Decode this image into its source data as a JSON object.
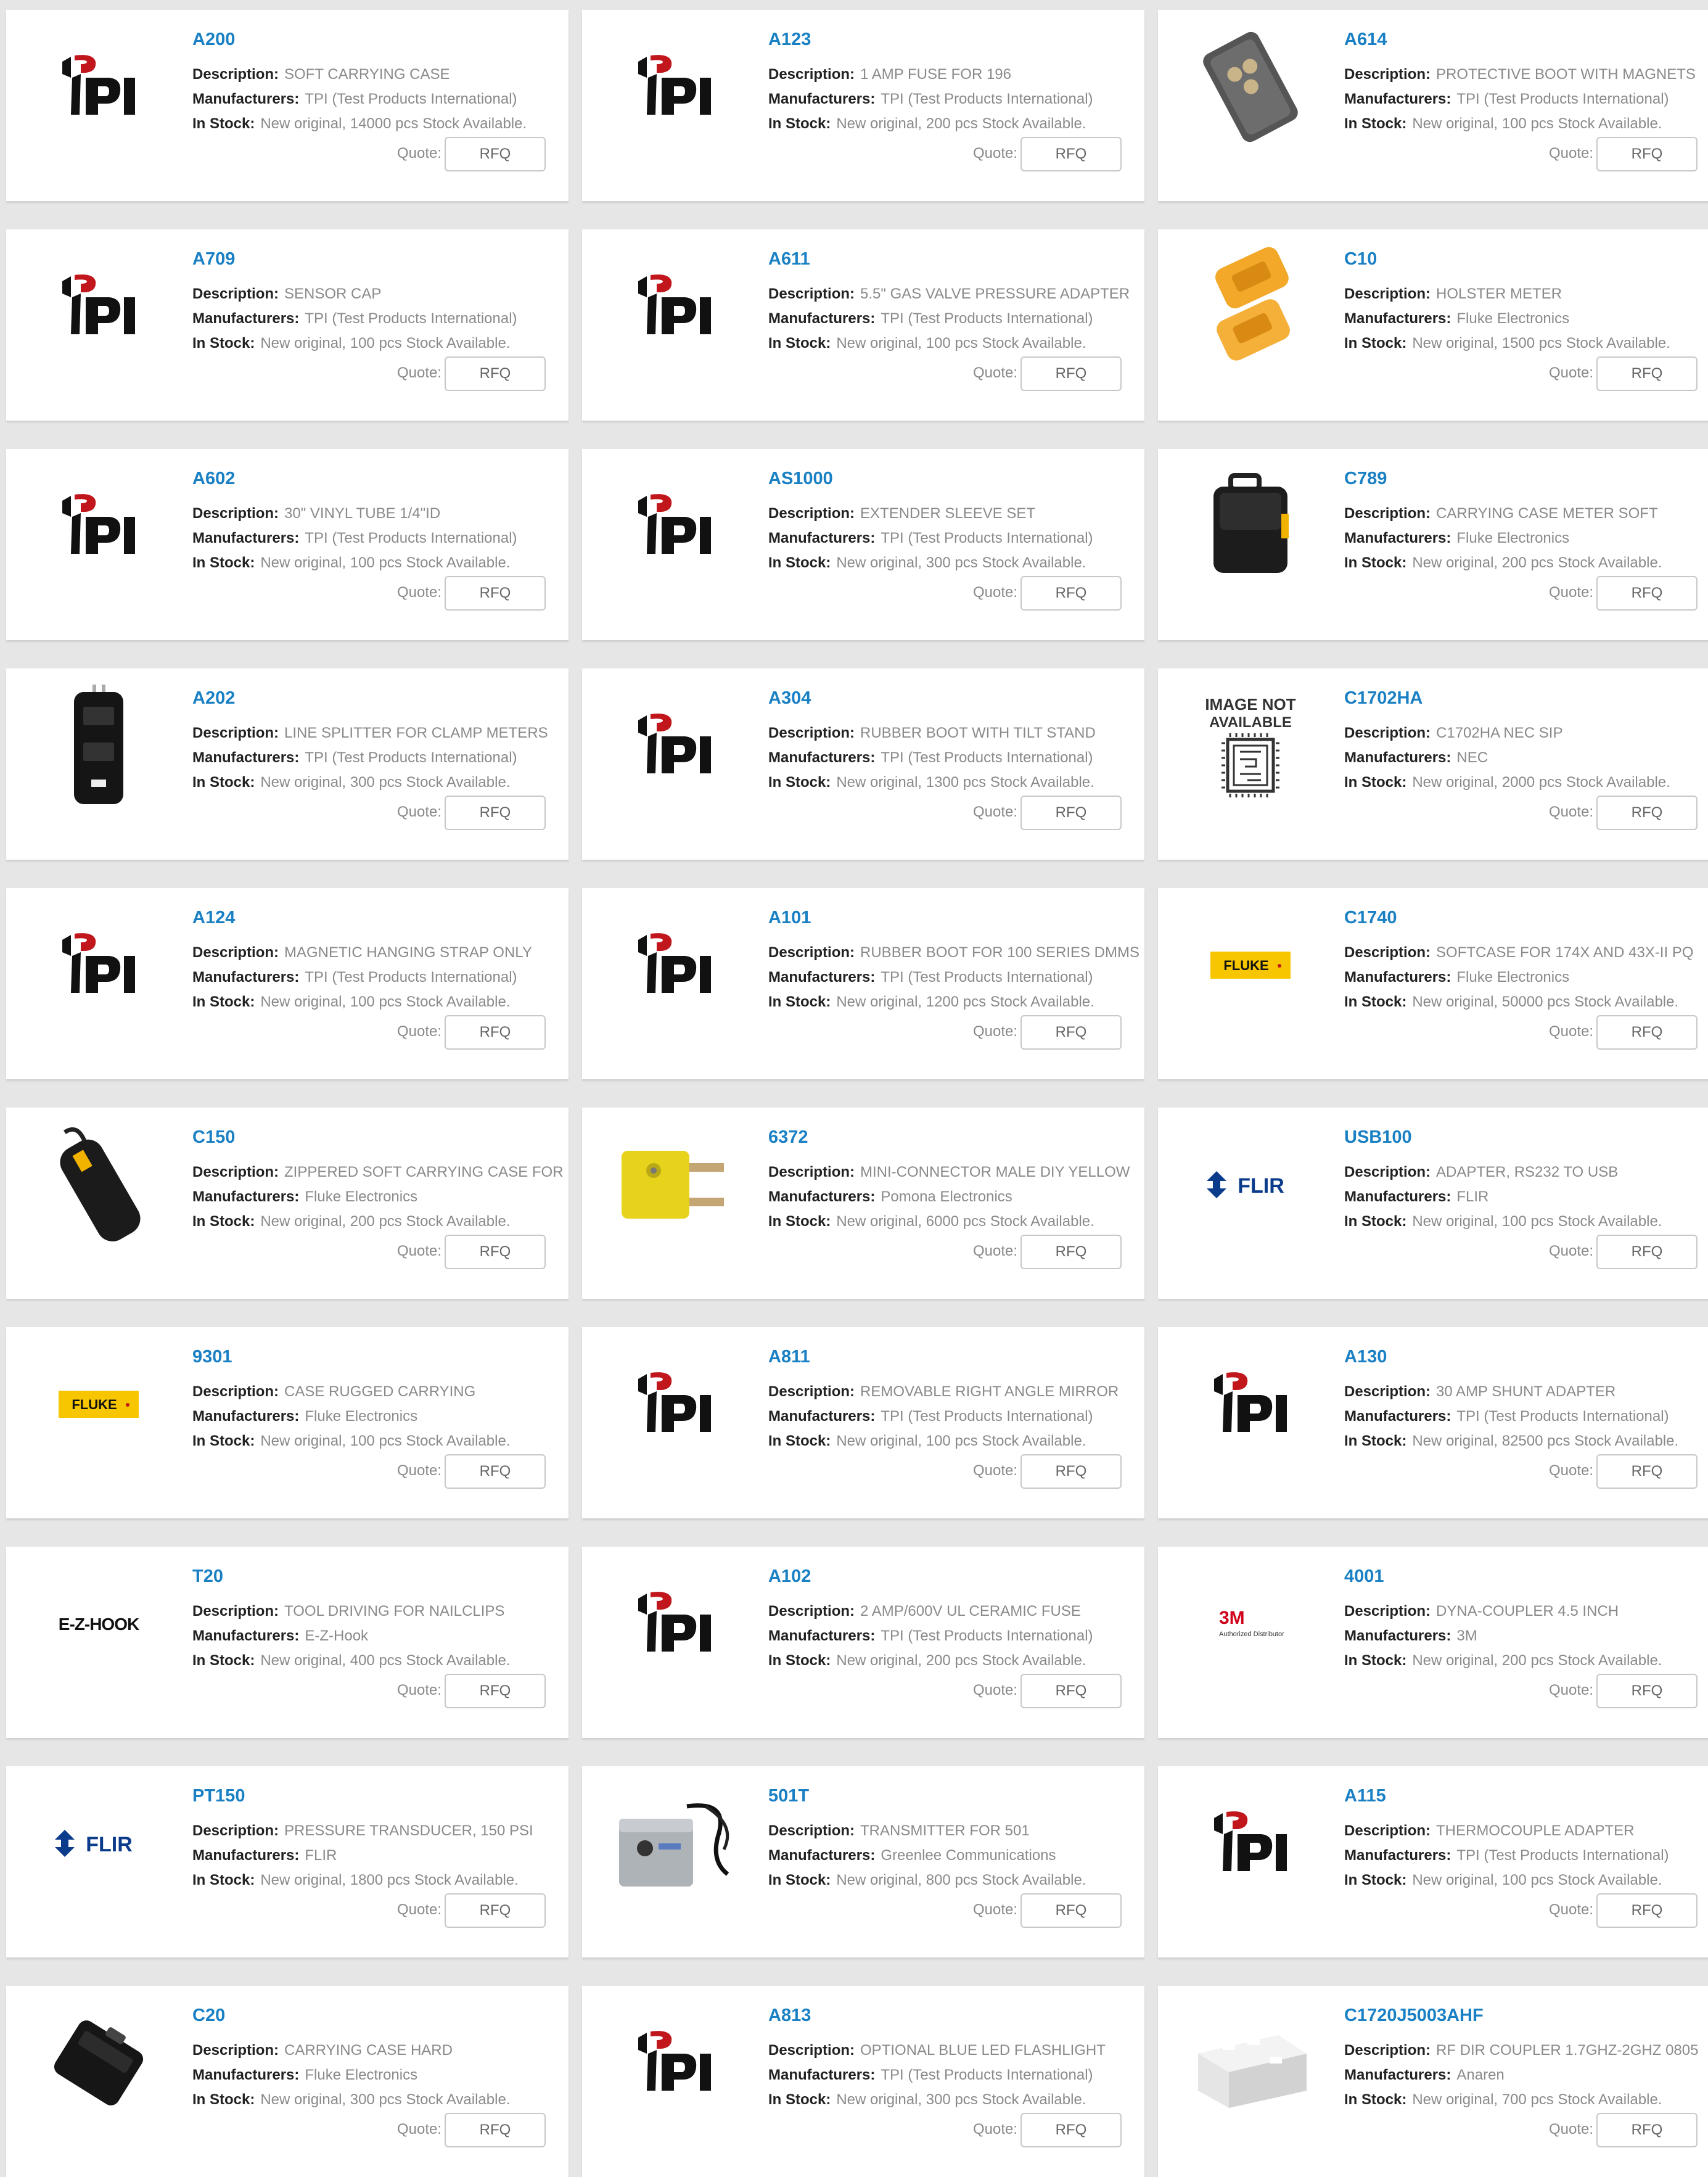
{
  "labels": {
    "description": "Description:",
    "manufacturers": "Manufacturers:",
    "in_stock": "In Stock:",
    "quote": "Quote:",
    "rfq": "RFQ"
  },
  "colors": {
    "part_number": "#1a80c4",
    "label": "#222222",
    "value": "#8a8a8a",
    "page_background": "#e6e6e6",
    "card_background": "#ffffff"
  },
  "logos": {
    "tpi": "tpi",
    "fluke": "FLUKE",
    "flir": "FLIR",
    "ezhook": "E-Z-HOOK",
    "threem": "3M",
    "threem_sub": "Authorized Distributor",
    "image_na_1": "IMAGE NOT",
    "image_na_2": "AVAILABLE"
  },
  "products": [
    {
      "part": "A200",
      "description": "SOFT CARRYING CASE",
      "manufacturer": "TPI (Test Products International)",
      "stock": "New original, 14000 pcs Stock Available.",
      "image": "tpi-logo"
    },
    {
      "part": "A123",
      "description": "1 AMP FUSE FOR 196",
      "manufacturer": "TPI (Test Products International)",
      "stock": "New original, 200 pcs Stock Available.",
      "image": "tpi-logo"
    },
    {
      "part": "A614",
      "description": "PROTECTIVE BOOT WITH MAGNETS",
      "manufacturer": "TPI (Test Products International)",
      "stock": "New original, 100 pcs Stock Available.",
      "image": "gray-boot"
    },
    {
      "part": "A709",
      "description": "SENSOR CAP",
      "manufacturer": "TPI (Test Products International)",
      "stock": "New original, 100 pcs Stock Available.",
      "image": "tpi-logo"
    },
    {
      "part": "A611",
      "description": "5.5\" GAS VALVE PRESSURE ADAPTER",
      "manufacturer": "TPI (Test Products International)",
      "stock": "New original, 100 pcs Stock Available.",
      "image": "tpi-logo"
    },
    {
      "part": "C10",
      "description": "HOLSTER METER",
      "manufacturer": "Fluke Electronics",
      "stock": "New original, 1500 pcs Stock Available.",
      "image": "yellow-holster"
    },
    {
      "part": "A602",
      "description": "30\" VINYL TUBE 1/4\"ID",
      "manufacturer": "TPI (Test Products International)",
      "stock": "New original, 100 pcs Stock Available.",
      "image": "tpi-logo"
    },
    {
      "part": "AS1000",
      "description": "EXTENDER SLEEVE SET",
      "manufacturer": "TPI (Test Products International)",
      "stock": "New original, 300 pcs Stock Available.",
      "image": "tpi-logo"
    },
    {
      "part": "C789",
      "description": "CARRYING CASE METER SOFT",
      "manufacturer": "Fluke Electronics",
      "stock": "New original, 200 pcs Stock Available.",
      "image": "black-case"
    },
    {
      "part": "A202",
      "description": "LINE SPLITTER FOR CLAMP METERS",
      "manufacturer": "TPI (Test Products International)",
      "stock": "New original, 300 pcs Stock Available.",
      "image": "line-splitter"
    },
    {
      "part": "A304",
      "description": "RUBBER BOOT WITH TILT STAND",
      "manufacturer": "TPI (Test Products International)",
      "stock": "New original, 1300 pcs Stock Available.",
      "image": "tpi-logo"
    },
    {
      "part": "C1702HA",
      "description": "C1702HA NEC SIP",
      "manufacturer": "NEC",
      "stock": "New original, 2000 pcs Stock Available.",
      "image": "image-not-available"
    },
    {
      "part": "A124",
      "description": "MAGNETIC HANGING STRAP ONLY",
      "manufacturer": "TPI (Test Products International)",
      "stock": "New original, 100 pcs Stock Available.",
      "image": "tpi-logo"
    },
    {
      "part": "A101",
      "description": "RUBBER BOOT FOR 100 SERIES DMMS",
      "manufacturer": "TPI (Test Products International)",
      "stock": "New original, 1200 pcs Stock Available.",
      "image": "tpi-logo"
    },
    {
      "part": "C1740",
      "description": "SOFTCASE FOR 174X AND 43X-II PQ",
      "manufacturer": "Fluke Electronics",
      "stock": "New original, 50000 pcs Stock Available.",
      "image": "fluke-logo"
    },
    {
      "part": "C150",
      "description": "ZIPPERED SOFT CARRYING CASE FOR",
      "manufacturer": "Fluke Electronics",
      "stock": "New original, 200 pcs Stock Available.",
      "image": "zip-case"
    },
    {
      "part": "6372",
      "description": "MINI-CONNECTOR MALE DIY YELLOW",
      "manufacturer": "Pomona Electronics",
      "stock": "New original, 6000 pcs Stock Available.",
      "image": "yellow-connector"
    },
    {
      "part": "USB100",
      "description": "ADAPTER, RS232 TO USB",
      "manufacturer": "FLIR",
      "stock": "New original, 100 pcs Stock Available.",
      "image": "flir-logo"
    },
    {
      "part": "9301",
      "description": "CASE RUGGED CARRYING",
      "manufacturer": "Fluke Electronics",
      "stock": "New original, 100 pcs Stock Available.",
      "image": "fluke-logo"
    },
    {
      "part": "A811",
      "description": "REMOVABLE RIGHT ANGLE MIRROR",
      "manufacturer": "TPI (Test Products International)",
      "stock": "New original, 100 pcs Stock Available.",
      "image": "tpi-logo"
    },
    {
      "part": "A130",
      "description": "30 AMP SHUNT ADAPTER",
      "manufacturer": "TPI (Test Products International)",
      "stock": "New original, 82500 pcs Stock Available.",
      "image": "tpi-logo"
    },
    {
      "part": "T20",
      "description": "TOOL DRIVING FOR NAILCLIPS",
      "manufacturer": "E-Z-Hook",
      "stock": "New original, 400 pcs Stock Available.",
      "image": "ezhook-logo"
    },
    {
      "part": "A102",
      "description": "2 AMP/600V UL CERAMIC FUSE",
      "manufacturer": "TPI (Test Products International)",
      "stock": "New original, 200 pcs Stock Available.",
      "image": "tpi-logo"
    },
    {
      "part": "4001",
      "description": "DYNA-COUPLER 4.5 INCH",
      "manufacturer": "3M",
      "stock": "New original, 200 pcs Stock Available.",
      "image": "threem-logo"
    },
    {
      "part": "PT150",
      "description": "PRESSURE TRANSDUCER, 150 PSI",
      "manufacturer": "FLIR",
      "stock": "New original, 1800 pcs Stock Available.",
      "image": "flir-logo"
    },
    {
      "part": "501T",
      "description": "TRANSMITTER FOR 501",
      "manufacturer": "Greenlee Communications",
      "stock": "New original, 800 pcs Stock Available.",
      "image": "transmitter"
    },
    {
      "part": "A115",
      "description": "THERMOCOUPLE ADAPTER",
      "manufacturer": "TPI (Test Products International)",
      "stock": "New original, 100 pcs Stock Available.",
      "image": "tpi-logo"
    },
    {
      "part": "C20",
      "description": "CARRYING CASE HARD",
      "manufacturer": "Fluke Electronics",
      "stock": "New original, 300 pcs Stock Available.",
      "image": "hard-case"
    },
    {
      "part": "A813",
      "description": "OPTIONAL BLUE LED FLASHLIGHT",
      "manufacturer": "TPI (Test Products International)",
      "stock": "New original, 300 pcs Stock Available.",
      "image": "tpi-logo"
    },
    {
      "part": "C1720J5003AHF",
      "description": "RF DIR COUPLER 1.7GHZ-2GHZ 0805",
      "manufacturer": "Anaren",
      "stock": "New original, 700 pcs Stock Available.",
      "image": "white-chip"
    }
  ]
}
